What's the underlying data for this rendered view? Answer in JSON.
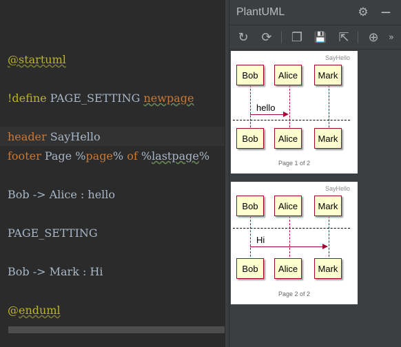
{
  "editor": {
    "line1": "@startuml",
    "line2_bang": "!define ",
    "line2_name": "PAGE_SETTING ",
    "line2_kw": "newpage",
    "line3_kw": "header",
    "line3_text": " SayHello",
    "line4_kw": "footer",
    "line4_a": " Page %",
    "line4_page": "page",
    "line4_b": "% ",
    "line4_of": "of",
    "line4_c": " %",
    "line4_last": "lastpage",
    "line4_d": "%",
    "line5": "Bob -> Alice : hello",
    "line6": "PAGE_SETTING",
    "line7": "Bob -> Mark : Hi",
    "line8_at": "@",
    "line8_end": "enduml"
  },
  "panel": {
    "title": "PlantUML",
    "gear_icon": "⚙",
    "minimize_icon": "—",
    "toolbar": {
      "refresh": "↻",
      "reload": "⟳",
      "copy": "❐",
      "save": "💾",
      "open_external": "⇱",
      "zoom_in": "⊕",
      "more": "»"
    }
  },
  "diagram1": {
    "header": "SayHello",
    "participants": [
      "Bob",
      "Alice",
      "Mark"
    ],
    "message": "hello",
    "footer": "Page 1 of 2"
  },
  "diagram2": {
    "header": "SayHello",
    "participants": [
      "Bob",
      "Alice",
      "Mark"
    ],
    "message": "Hi",
    "footer": "Page 2 of 2"
  },
  "colors": {
    "editor_bg": "#2b2b2b",
    "keyword": "#cc7832",
    "annotation": "#bbb529",
    "text": "#a9b7c6",
    "participant_fill": "#fefece",
    "participant_border": "#a80036"
  }
}
